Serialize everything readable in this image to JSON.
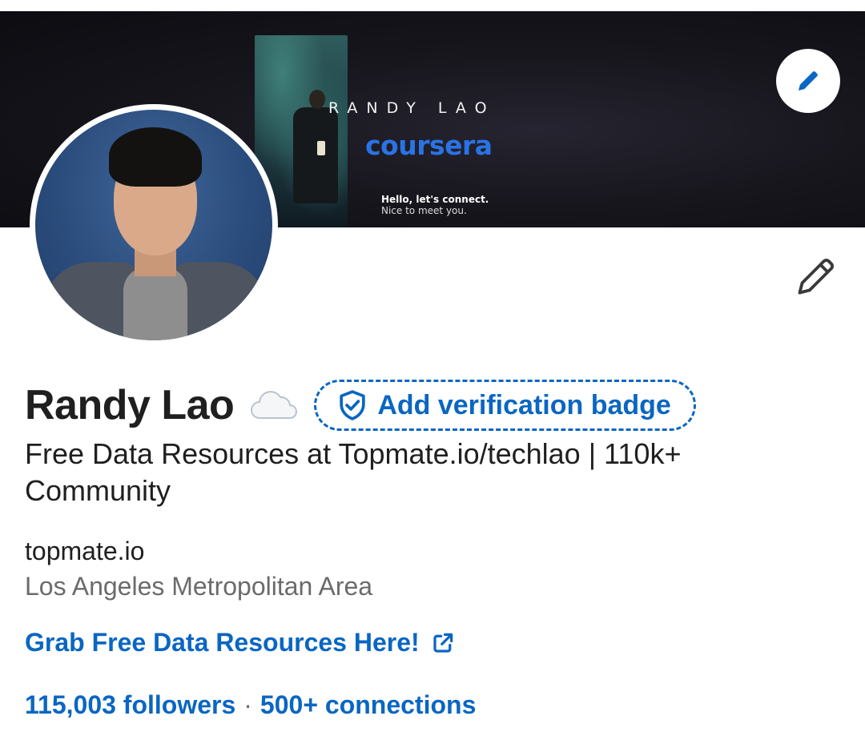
{
  "banner": {
    "name": "RANDY LAO",
    "brand": "coursera",
    "hello": "Hello, let's connect.",
    "nice": "Nice to meet you."
  },
  "profile": {
    "name": "Randy Lao",
    "status_icon": "cloud-icon",
    "verification_label": "Add verification badge",
    "headline": "Free Data Resources at Topmate.io/techlao | 110k+ Community",
    "company": "topmate.io",
    "location": "Los Angeles Metropolitan Area",
    "link_label": "Grab Free Data Resources Here!",
    "followers": "115,003 followers",
    "separator": "·",
    "connections": "500+ connections"
  },
  "colors": {
    "accent": "#0a66c2",
    "brand_blue": "#2a73e6",
    "text": "#1f1f1f",
    "secondary_text": "#6b6b6b"
  }
}
